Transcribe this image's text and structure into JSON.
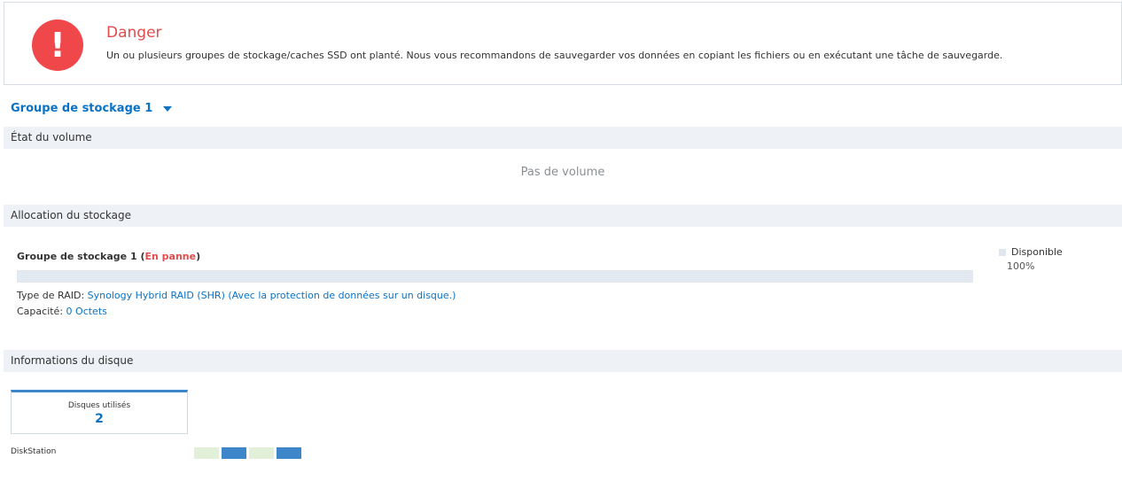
{
  "alert": {
    "icon": "exclamation-icon",
    "icon_glyph": "!",
    "title": "Danger",
    "message": "Un ou plusieurs groupes de stockage/caches SSD ont planté. Nous vous recommandons de sauvegarder vos données en copiant les fichiers ou en exécutant une tâche de sauvegarde.",
    "color": "#f0474a"
  },
  "pool_selector": {
    "label": "Groupe de stockage 1",
    "icon": "caret-down-icon"
  },
  "volume_section": {
    "title": "État du volume",
    "empty_text": "Pas de volume"
  },
  "allocation_section": {
    "title": "Allocation du stockage",
    "pool_name": "Groupe de stockage 1",
    "pool_status": "En panne",
    "raid_label": "Type de RAID:",
    "raid_value": "Synology Hybrid RAID (SHR) (Avec la protection de données sur un disque.)",
    "capacity_label": "Capacité:",
    "capacity_value": "0 Octets",
    "legend_label": "Disponible",
    "legend_value": "100%",
    "available_fraction": 1.0
  },
  "disk_section": {
    "title": "Informations du disque",
    "card_label": "Disques utilisés",
    "card_value": "2",
    "device_label": "DiskStation",
    "slots": [
      {
        "state": "empty",
        "color": "#e2efd9"
      },
      {
        "state": "used",
        "color": "#3d86c9"
      },
      {
        "state": "empty",
        "color": "#e2efd9"
      },
      {
        "state": "used",
        "color": "#3d86c9"
      }
    ]
  }
}
